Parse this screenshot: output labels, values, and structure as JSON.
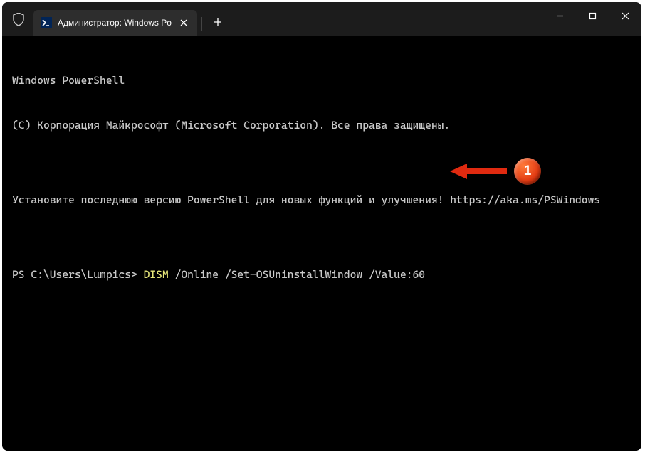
{
  "tab": {
    "title": "Администратор: Windows Po"
  },
  "terminal": {
    "line1": "Windows PowerShell",
    "line2": "(C) Корпорация Майкрософт (Microsoft Corporation). Все права защищены.",
    "line3": "",
    "line4": "Установите последнюю версию PowerShell для новых функций и улучшения! https://aka.ms/PSWindows",
    "line5": "",
    "prompt": "PS C:\\Users\\Lumpics> ",
    "cmd_keyword": "DISM ",
    "cmd_rest": "/Online /Set-OSUninstallWindow /Value:60"
  },
  "annotation": {
    "number": "1"
  }
}
